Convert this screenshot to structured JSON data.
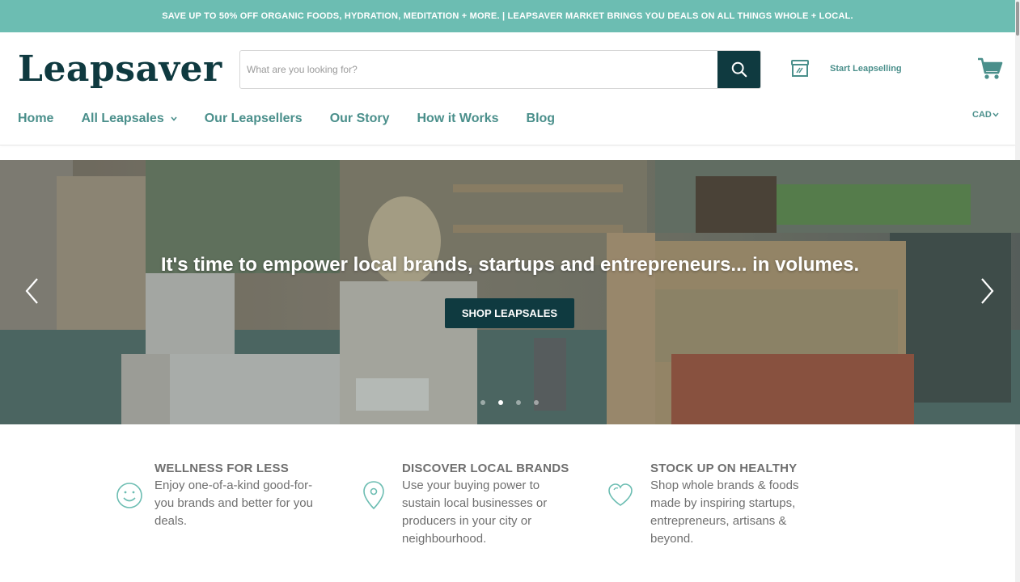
{
  "announcement": "SAVE UP TO 50% OFF ORGANIC FOODS, HYDRATION, MEDITATION + MORE. | LEAPSAVER MARKET BRINGS YOU DEALS ON ALL THINGS WHOLE + LOCAL.",
  "brand": {
    "logo": "Leapsaver"
  },
  "search": {
    "placeholder": "What are you looking for?",
    "value": ""
  },
  "header": {
    "seller_link": "Start Leapselling",
    "currency": "CAD"
  },
  "nav": {
    "items": [
      {
        "label": "Home"
      },
      {
        "label": "All Leapsales",
        "has_dropdown": true
      },
      {
        "label": "Our Leapsellers"
      },
      {
        "label": "Our Story"
      },
      {
        "label": "How it Works"
      },
      {
        "label": "Blog"
      }
    ]
  },
  "hero": {
    "title": "It's time to empower local brands, startups and entrepreneurs... in volumes.",
    "cta": "SHOP LEAPSALES",
    "slide_count": 4,
    "active_slide": 2
  },
  "features": [
    {
      "icon": "smile-icon",
      "title": "WELLNESS FOR LESS",
      "lines": [
        "Enjoy one-of-a-kind good-for-",
        "you brands and better for you",
        "deals."
      ]
    },
    {
      "icon": "location-pin-icon",
      "title": "DISCOVER LOCAL BRANDS",
      "lines": [
        "Use your buying power to",
        "sustain local businesses or",
        "producers in your city or",
        "neighbourhood."
      ]
    },
    {
      "icon": "heart-icon",
      "title": "STOCK UP ON HEALTHY",
      "lines": [
        "Shop whole brands & foods",
        "made by inspiring startups,",
        "entrepreneurs, artisans &",
        "beyond."
      ]
    }
  ],
  "colors": {
    "accent": "#6cbdb2",
    "brand_dark": "#0f3a40",
    "nav_text": "#4a8f8b",
    "muted_text": "#6f6f6f"
  }
}
